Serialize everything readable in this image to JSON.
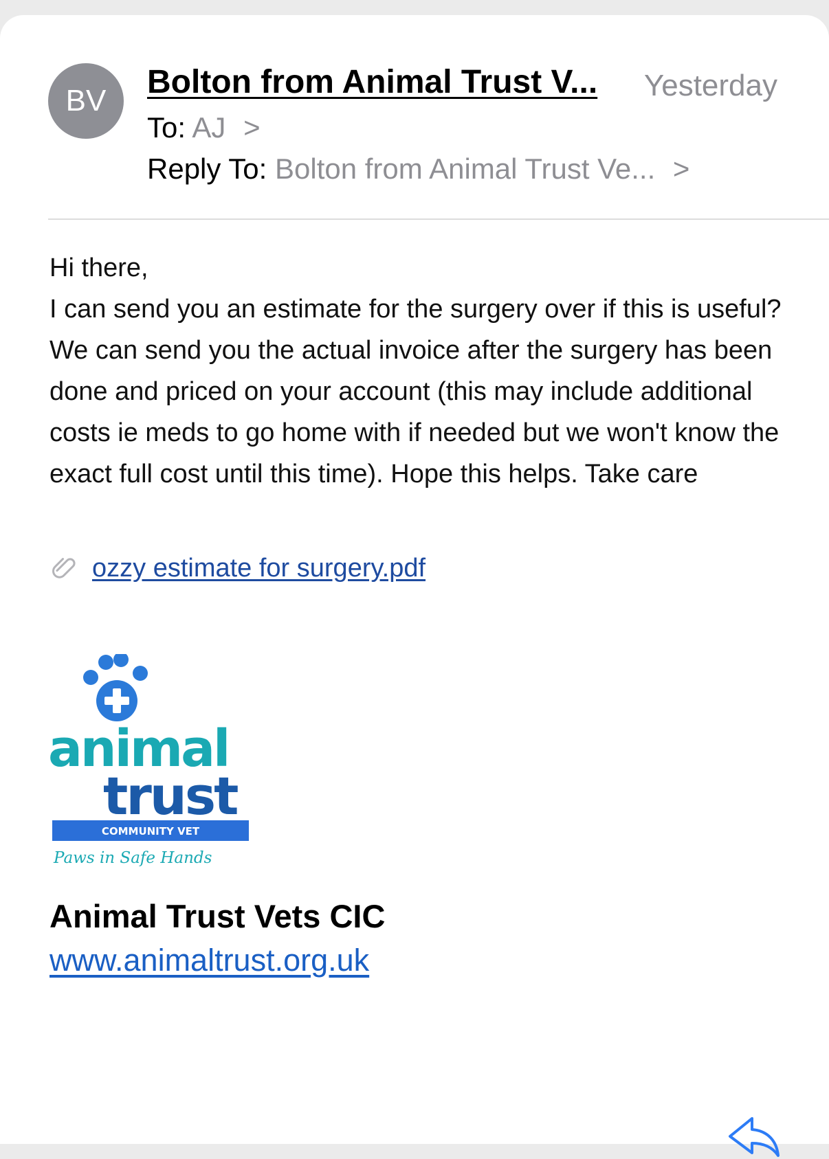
{
  "header": {
    "avatar_initials": "BV",
    "sender": "Bolton from Animal Trust V...",
    "date": "Yesterday",
    "to_label": "To:",
    "to_value": "AJ",
    "reply_to_label": "Reply To:",
    "reply_to_value": "Bolton from Animal Trust Ve...",
    "chevron": ">"
  },
  "body": {
    "greeting": "Hi there,",
    "message": "I can send you an estimate for the surgery over if this is useful? We can send you the actual invoice after the surgery has been done and priced on your account (this may include additional costs ie meds to go home with if needed but we won't know the exact full cost until this time). Hope this helps. Take care"
  },
  "attachment": {
    "filename": "ozzy estimate for surgery.pdf",
    "icon": "paperclip-icon"
  },
  "signature": {
    "logo_word_1": "animal",
    "logo_word_2": "trust",
    "logo_banner": "COMMUNITY VET",
    "logo_tagline": "Paws in Safe Hands",
    "org_name": "Animal Trust Vets CIC",
    "website": "www.animaltrust.org.uk"
  },
  "toolbar": {
    "reply_icon": "reply-arrow-icon"
  },
  "colors": {
    "avatar_bg": "#8e8f95",
    "secondary_text": "#8e8e93",
    "link": "#1a5fc4",
    "logo_teal": "#1aa9b3",
    "logo_blue": "#2b7ad9",
    "logo_dark": "#1c5aa8"
  }
}
